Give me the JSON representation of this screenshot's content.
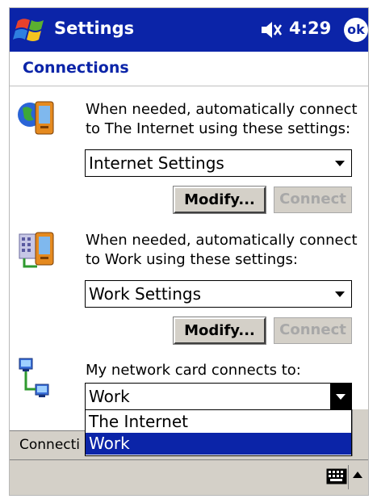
{
  "titlebar": {
    "app_title": "Settings",
    "time": "4:29",
    "ok_label": "ok",
    "start_icon": "windows-flag-icon",
    "volume_icon": "speaker-muted-icon"
  },
  "page": {
    "title": "Connections"
  },
  "sections": [
    {
      "description_line1": "When needed, automatically connect",
      "description_line2": "to The Internet using these settings:",
      "selected": "Internet Settings",
      "modify_label": "Modify...",
      "connect_label": "Connect",
      "icon": "internet-globe-pda-icon"
    },
    {
      "description_line1": "When needed, automatically connect",
      "description_line2": "to Work using these settings:",
      "selected": "Work Settings",
      "modify_label": "Modify...",
      "connect_label": "Connect",
      "icon": "work-building-pda-icon"
    },
    {
      "description_line1": "My network card connects to:",
      "selected": "Work",
      "icon": "network-card-icon"
    }
  ],
  "dropdown": {
    "options": [
      "The Internet",
      "Work"
    ],
    "selected_index": 1
  },
  "tabbar": {
    "label": "Connecti"
  },
  "menubar": {
    "keyboard_icon": "keyboard-icon",
    "sip_arrow_icon": "up-arrow-icon"
  },
  "colors": {
    "title_bar": "#0b24a8",
    "selection": "#0b24a8",
    "chrome": "#d4d0c8"
  }
}
